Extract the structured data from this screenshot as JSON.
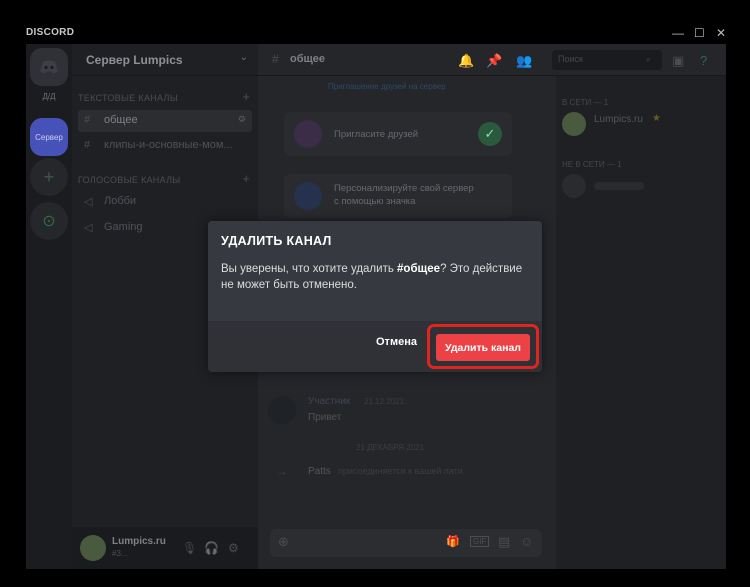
{
  "titlebar": {
    "brand": "DISCORD",
    "minimize": "—",
    "maximize": "☐",
    "close": "✕"
  },
  "rail": {
    "home_label": "Д/Д",
    "server_label": "Сервер",
    "add": "+",
    "explore": "⊙"
  },
  "sidebar": {
    "server_name": "Сервер Lumpics",
    "text_category": "ТЕКСТОВЫЕ КАНАЛЫ",
    "voice_category": "ГОЛОСОВЫЕ КАНАЛЫ",
    "text_channels": [
      {
        "name": "общее"
      },
      {
        "name": "клипы-и-основные-мом..."
      }
    ],
    "voice_channels": [
      {
        "name": "Лобби"
      },
      {
        "name": "Gaming"
      }
    ],
    "user": {
      "name": "Lumpics.ru",
      "tag": "#3..."
    }
  },
  "chat": {
    "channel_name": "общее",
    "search_placeholder": "Поиск",
    "top_link": "Приглашение друзей на сервер",
    "card1": "Пригласите друзей",
    "card2_line1": "Персонализируйте свой сервер",
    "card2_line2": "с помощью значка",
    "msg_author": "Участник",
    "msg_time": "21.12.2021",
    "msg_text": "Привет",
    "divider": "21 ДЕКАБРЯ 2021",
    "join_name": "Patts",
    "join_text": "присоединяется к вашей пати."
  },
  "members": {
    "online_header": "В СЕТИ — 1",
    "member1": "Lumpics.ru",
    "offline_header": "НЕ В СЕТИ — 1"
  },
  "modal": {
    "title": "УДАЛИТЬ КАНАЛ",
    "text_before": "Вы уверены, что хотите удалить ",
    "channel": "#общее",
    "text_after": "? Это действие не может быть отменено.",
    "cancel": "Отмена",
    "confirm": "Удалить канал"
  },
  "colors": {
    "danger": "#ed4245",
    "highlight": "#e0251f",
    "modal_bg": "#36393f",
    "modal_footer": "#2f3136"
  }
}
